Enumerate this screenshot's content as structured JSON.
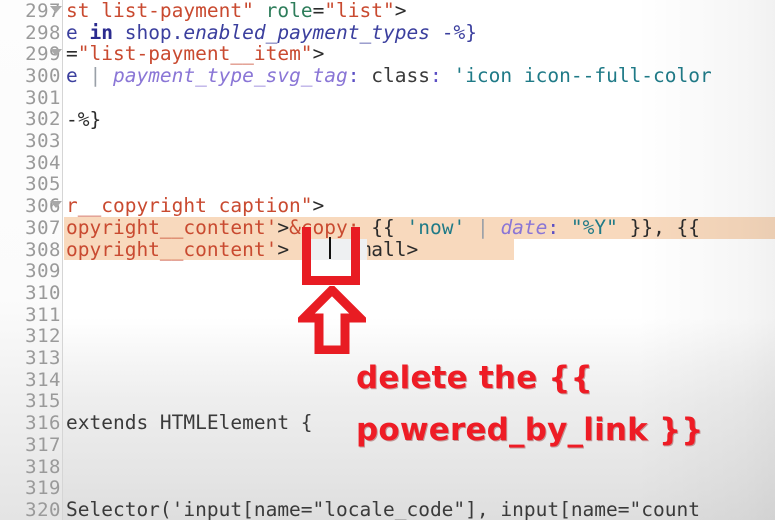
{
  "editor": {
    "name": "code-editor",
    "first_line": 297,
    "gutter_width": 63,
    "line_height": 21.7,
    "fold_lines": [
      297,
      299,
      306
    ],
    "highlight_line": 308,
    "caret_line": 308,
    "colors": {
      "highlight_bg": "#f8d9bd",
      "selection_bg": "#eef0f2",
      "gutter_text": "#9a9a9a",
      "tag": "#c94a30",
      "string": "#1f7a87",
      "filter": "#8a76d6",
      "keyword": "#2b2b8f",
      "annotation_red": "#ee1c25"
    },
    "lines": [
      {
        "num": 297,
        "text": "st list-payment\" role=\"list\">"
      },
      {
        "num": 298,
        "text": "e in shop.enabled_payment_types -%}"
      },
      {
        "num": 299,
        "text": "=\"list-payment__item\">"
      },
      {
        "num": 300,
        "text": " | payment_type_svg_tag: class: 'icon icon--full-color"
      },
      {
        "num": 301,
        "text": ""
      },
      {
        "num": 302,
        "text": "-%}"
      },
      {
        "num": 303,
        "text": ""
      },
      {
        "num": 304,
        "text": ""
      },
      {
        "num": 305,
        "text": ""
      },
      {
        "num": 306,
        "text": "r__copyright caption\">"
      },
      {
        "num": 307,
        "text": "opyright__content'>&copy; {{ 'now' | date: \"%Y\" }}, {{"
      },
      {
        "num": 308,
        "text": "opyright__content'>   </small>"
      },
      {
        "num": 309,
        "text": ""
      },
      {
        "num": 310,
        "text": ""
      },
      {
        "num": 311,
        "text": ""
      },
      {
        "num": 312,
        "text": ""
      },
      {
        "num": 313,
        "text": ""
      },
      {
        "num": 314,
        "text": ""
      },
      {
        "num": 315,
        "text": ""
      },
      {
        "num": 316,
        "text": "extends HTMLElement {"
      },
      {
        "num": 317,
        "text": ""
      },
      {
        "num": 318,
        "text": ""
      },
      {
        "num": 319,
        "text": ""
      },
      {
        "num": 320,
        "text": "Selector('input[name=\"locale_code\"], input[name=\"count"
      }
    ]
  },
  "annotation": {
    "name": "delete-instruction",
    "line1": "delete the {{",
    "line2": "powered_by_link }}",
    "color": "#ee1c25",
    "shape": "rectangle-with-up-arrow",
    "target_line": 308
  },
  "line_numbers": [
    "297",
    "298",
    "299",
    "300",
    "301",
    "302",
    "303",
    "304",
    "305",
    "306",
    "307",
    "308",
    "309",
    "310",
    "311",
    "312",
    "313",
    "314",
    "315",
    "316",
    "317",
    "318",
    "319",
    "320"
  ]
}
